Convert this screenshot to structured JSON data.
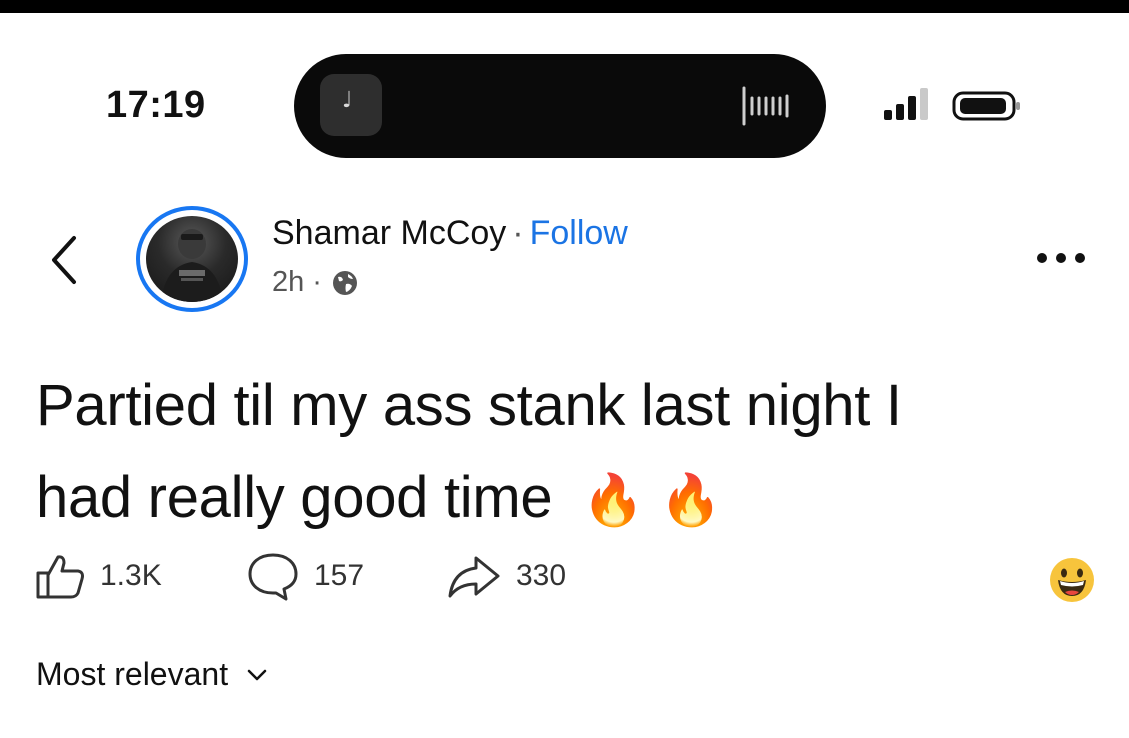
{
  "status_bar": {
    "time": "17:19",
    "island_app_icon": "music-note-icon",
    "island_activity_icon": "waveform-icon",
    "signal_icon": "cellular-signal-icon",
    "battery_icon": "battery-icon"
  },
  "post": {
    "author": "Shamar McCoy",
    "separator": "·",
    "follow_label": "Follow",
    "time_ago": "2h",
    "meta_separator": "·",
    "audience_icon": "globe-icon",
    "text_line1": "Partied til my ass stank last night I",
    "text_line2": "had really good time",
    "emojis": "🔥 🔥",
    "reactions": {
      "likes": "1.3K",
      "comments": "157",
      "shares": "330",
      "reaction_emoji": "grinning-face-icon"
    }
  },
  "comments": {
    "sort_label": "Most relevant"
  },
  "colors": {
    "accent": "#1b74e4",
    "avatar_ring": "#1877f2",
    "text": "#111111",
    "muted": "#555555"
  }
}
